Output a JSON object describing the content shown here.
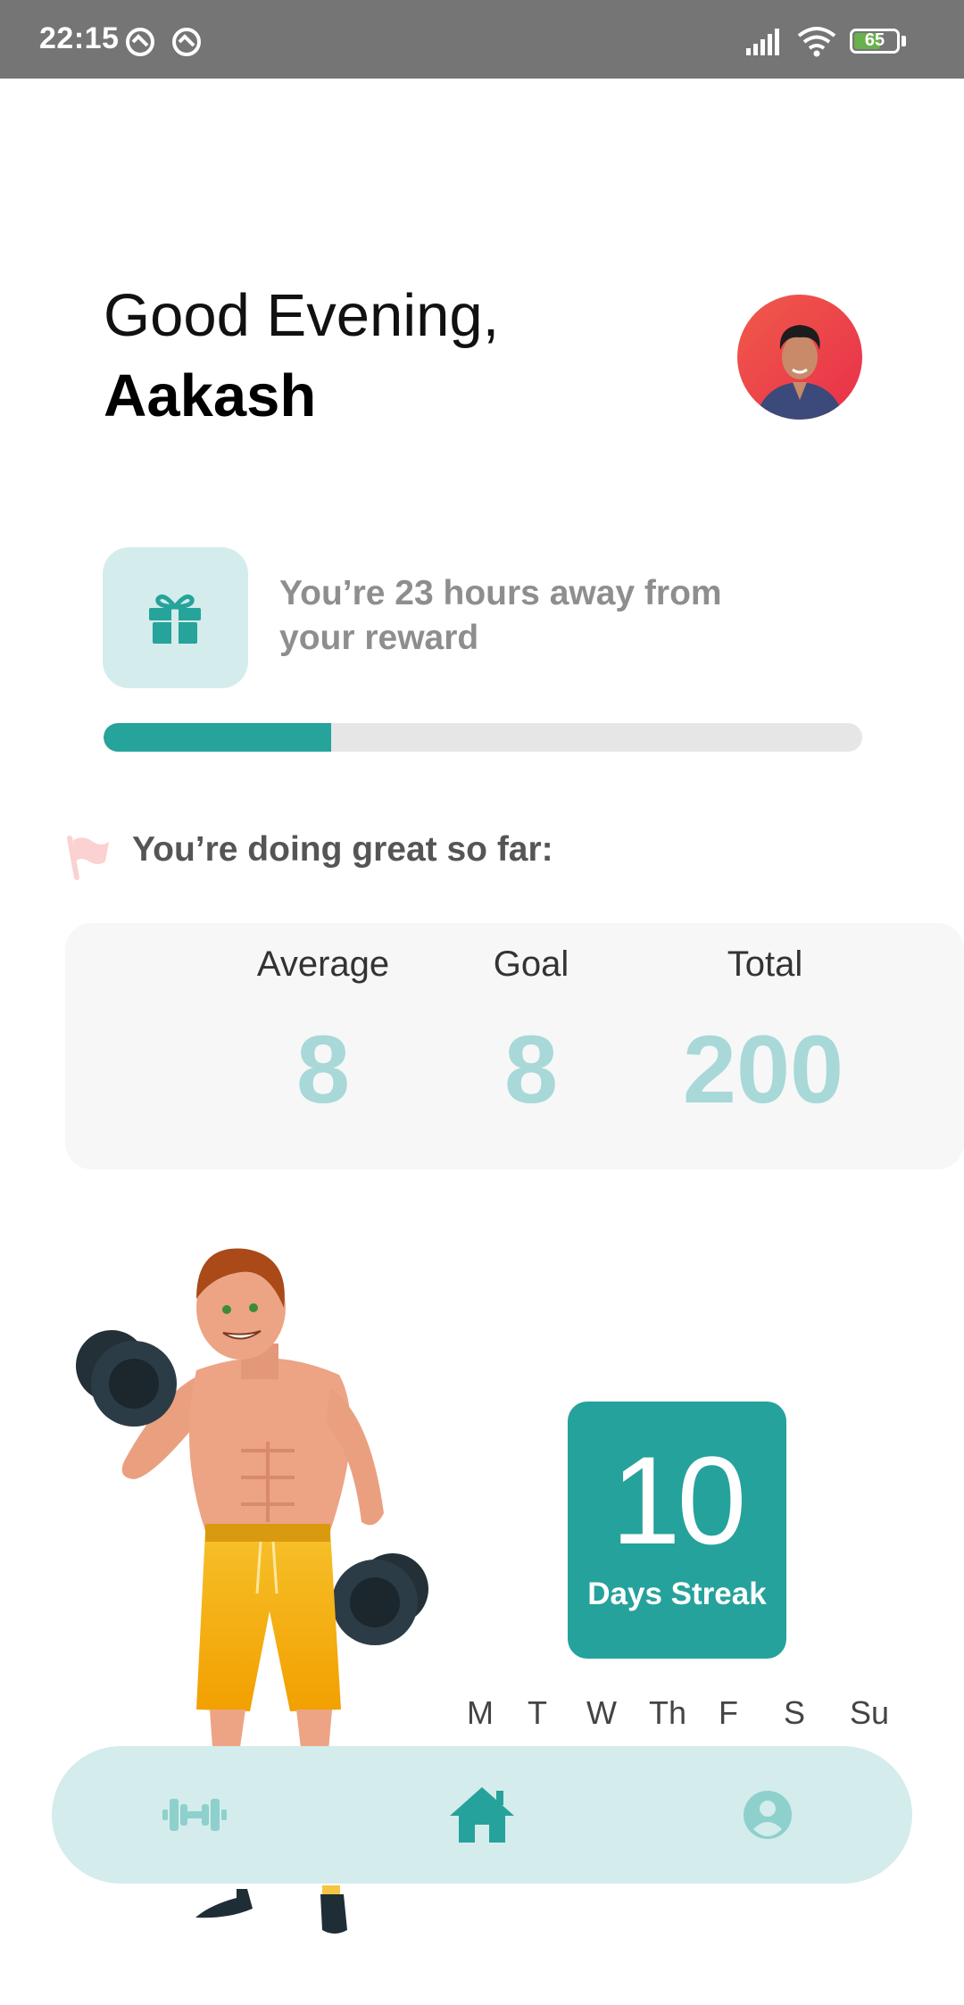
{
  "status_bar": {
    "time": "22:15",
    "battery": "65",
    "battery_level": 0.65,
    "icons": [
      "notification-icon",
      "notification-icon",
      "signal-icon",
      "wifi-icon",
      "battery-icon"
    ]
  },
  "header": {
    "greeting": "Good Evening,",
    "name": "Aakash"
  },
  "reward": {
    "icon": "gift-icon",
    "text": "You’re 23 hours away from your reward",
    "progress": 0.3
  },
  "summary": {
    "icon": "flag-icon",
    "title": "You’re doing great so far:",
    "stats": [
      {
        "label": "Average",
        "value": "8"
      },
      {
        "label": "Goal",
        "value": "8"
      },
      {
        "label": "Total",
        "value": "200"
      }
    ]
  },
  "streak": {
    "count": "10",
    "label": "Days Streak"
  },
  "week_days": [
    "M",
    "T",
    "W",
    "Th",
    "F",
    "S",
    "Su"
  ],
  "bottom_nav": {
    "items": [
      {
        "icon": "dumbbell-icon"
      },
      {
        "icon": "home-icon"
      },
      {
        "icon": "profile-icon"
      }
    ]
  },
  "colors": {
    "accent": "#25a29b",
    "accent_light": "#d4ecec",
    "stat_value": "#a8d8d8"
  }
}
